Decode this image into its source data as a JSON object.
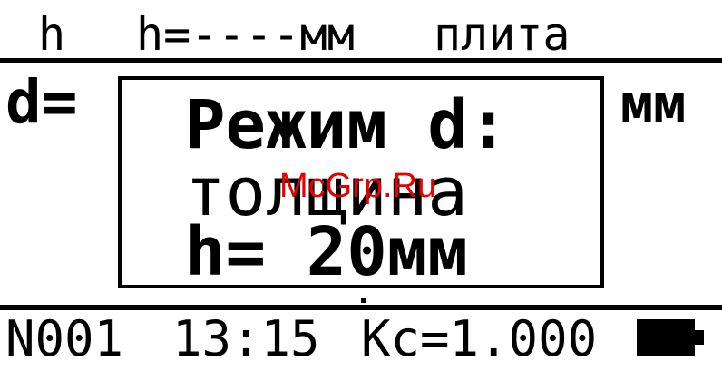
{
  "header": {
    "mode": "h",
    "height_readout": "h=----мм",
    "base": "плита"
  },
  "measurement": {
    "label": "d=",
    "unit": "мм"
  },
  "popup": {
    "line1": "Режим d:",
    "line2": "толщина",
    "line3": "h= 20мм"
  },
  "watermark": "McGrp.Ru",
  "footer": {
    "record": "N001",
    "time": "13:15",
    "coefficient": "Кс=1.000"
  },
  "icons": {
    "battery": "battery-full-icon"
  }
}
